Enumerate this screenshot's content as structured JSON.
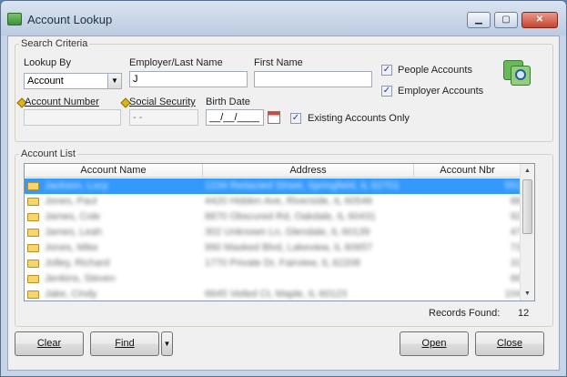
{
  "window": {
    "title": "Account Lookup"
  },
  "search_criteria": {
    "group_label": "Search Criteria",
    "lookup_by": {
      "label": "Lookup By",
      "value": "Account"
    },
    "employer_last_name": {
      "label": "Employer/Last Name",
      "value": "J"
    },
    "first_name": {
      "label": "First Name",
      "value": ""
    },
    "people_accounts": {
      "label": "People Accounts",
      "checked": true
    },
    "employer_accounts": {
      "label": "Employer Accounts",
      "checked": true
    },
    "account_number": {
      "label": "Account Number",
      "value": ""
    },
    "social_security": {
      "label": "Social Security",
      "value": "- -"
    },
    "birth_date": {
      "label": "Birth Date",
      "value": "__/__/____"
    },
    "existing_only": {
      "label": "Existing Accounts Only",
      "checked": true
    }
  },
  "account_list": {
    "group_label": "Account List",
    "columns": [
      "Account Name",
      "Address",
      "Account Nbr"
    ],
    "rows": [
      {
        "name": "Jackson, Lucy",
        "address": "1234 Redacted Street, Springfield, IL 62701",
        "nbr": "551",
        "selected": true
      },
      {
        "name": "Jones, Paul",
        "address": "4420 Hidden Ave, Riverside, IL 60546",
        "nbr": "88"
      },
      {
        "name": "James, Cole",
        "address": "8870 Obscured Rd, Oakdale, IL 60431",
        "nbr": "92"
      },
      {
        "name": "James, Leah",
        "address": "302 Unknown Ln, Glendale, IL 60139",
        "nbr": "47"
      },
      {
        "name": "Jones, Mike",
        "address": "990 Masked Blvd, Lakeview, IL 60657",
        "nbr": "73"
      },
      {
        "name": "Jolley, Richard",
        "address": "1770 Private Dr, Fairview, IL 62208",
        "nbr": "31"
      },
      {
        "name": "Jenkins, Steven",
        "address": "",
        "nbr": "66"
      },
      {
        "name": "Jake, Cindy",
        "address": "6645 Veiled Ct, Maple, IL 60123",
        "nbr": "104"
      }
    ],
    "records_found_label": "Records Found:",
    "records_found": "12"
  },
  "buttons": {
    "clear": "Clear",
    "find": "Find",
    "open": "Open",
    "close": "Close"
  }
}
